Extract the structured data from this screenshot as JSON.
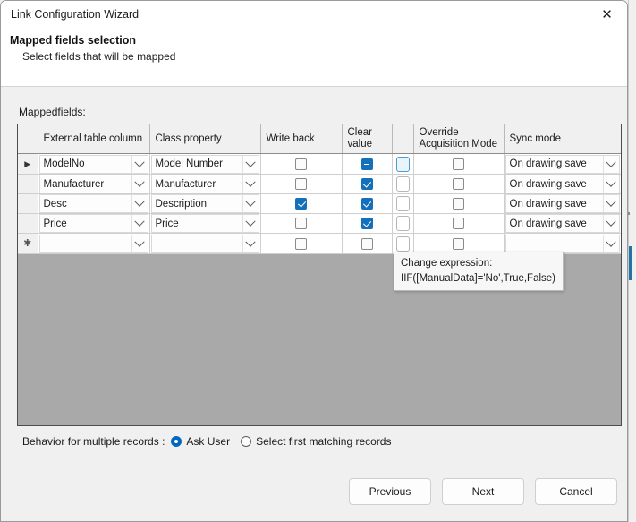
{
  "window": {
    "title": "Link Configuration Wizard",
    "close_icon": "close-icon"
  },
  "header": {
    "page_title": "Mapped fields selection",
    "page_subtitle": "Select fields that will be mapped"
  },
  "body": {
    "mapped_fields_label": "Mappedfields:"
  },
  "grid": {
    "columns": [
      {
        "key": "rowhead",
        "label": ""
      },
      {
        "key": "external",
        "label": "External table column"
      },
      {
        "key": "classprop",
        "label": "Class property"
      },
      {
        "key": "writeback",
        "label": "Write back"
      },
      {
        "key": "clearvalue",
        "label": "Clear\nvalue"
      },
      {
        "key": "expression",
        "label": ""
      },
      {
        "key": "override",
        "label": "Override\nAcquisition Mode"
      },
      {
        "key": "syncmode",
        "label": "Sync mode"
      }
    ],
    "column_labels": {
      "external": "External table column",
      "classprop": "Class property",
      "writeback": "Write back",
      "clearvalue_line1": "Clear",
      "clearvalue_line2": "value",
      "override_line1": "Override",
      "override_line2": "Acquisition Mode",
      "syncmode": "Sync mode"
    },
    "rows": [
      {
        "marker": "▶",
        "external": "ModelNo",
        "classprop": "Model Number",
        "writeback": "unchecked",
        "clearvalue": "indeterminate",
        "expression": "focused",
        "override": "unchecked",
        "syncmode": "On drawing save"
      },
      {
        "marker": "",
        "external": "Manufacturer",
        "classprop": "Manufacturer",
        "writeback": "unchecked",
        "clearvalue": "checked",
        "expression": "empty",
        "override": "unchecked",
        "syncmode": "On drawing save"
      },
      {
        "marker": "",
        "external": "Desc",
        "classprop": "Description",
        "writeback": "checked",
        "clearvalue": "checked",
        "expression": "empty",
        "override": "unchecked",
        "syncmode": "On drawing save"
      },
      {
        "marker": "",
        "external": "Price",
        "classprop": "Price",
        "writeback": "unchecked",
        "clearvalue": "checked",
        "expression": "empty",
        "override": "unchecked",
        "syncmode": "On drawing save"
      },
      {
        "marker": "✱",
        "external": "",
        "classprop": "",
        "writeback": "unchecked",
        "clearvalue": "unchecked",
        "expression": "empty",
        "override": "unchecked",
        "syncmode": ""
      }
    ]
  },
  "tooltip": {
    "line1": "Change expression:",
    "line2": "IIF([ManualData]='No',True,False)"
  },
  "behavior": {
    "label": "Behavior for multiple records :",
    "options": [
      {
        "label": "Ask User",
        "selected": true
      },
      {
        "label": "Select first matching records",
        "selected": false
      }
    ]
  },
  "footer": {
    "previous_label": "Previous",
    "next_label": "Next",
    "cancel_label": "Cancel"
  },
  "colors": {
    "accent": "#1570bb",
    "radio_accent": "#0067c0",
    "grid_filler": "#a9a9a9",
    "dialog_bg": "#f0f0f0"
  }
}
